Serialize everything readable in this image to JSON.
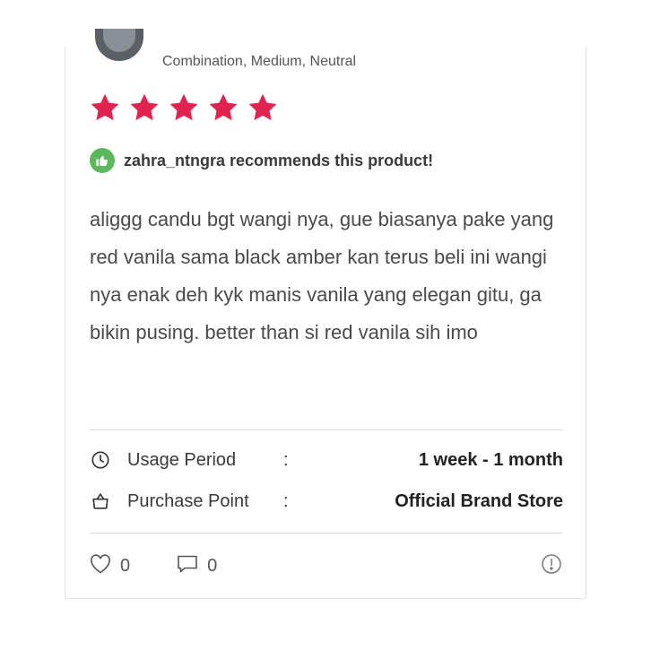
{
  "reviewer": {
    "skin_profile": "Combination, Medium, Neutral",
    "recommendation": "zahra_ntngra recommends this product!"
  },
  "rating": {
    "stars": 5,
    "max": 5,
    "star_color": "#e0244f"
  },
  "review": {
    "text": "aliggg candu bgt wangi nya, gue biasanya pake yang red vanila sama black amber kan terus beli ini wangi nya enak deh kyk manis vanila yang elegan gitu, ga bikin pusing. better than si red vanila sih imo"
  },
  "details": {
    "usage_period": {
      "label": "Usage Period",
      "separator": ":",
      "value": "1 week - 1 month",
      "icon": "clock-icon"
    },
    "purchase_point": {
      "label": "Purchase Point",
      "separator": ":",
      "value": "Official Brand Store",
      "icon": "shopping-bag-icon"
    }
  },
  "actions": {
    "likes": "0",
    "comments": "0",
    "like_icon": "heart-icon",
    "comment_icon": "comment-icon",
    "report_icon": "report-icon"
  },
  "colors": {
    "recommend_badge": "#5cb85c",
    "divider": "#dcdcdc",
    "card_border": "#e3e3e3"
  }
}
